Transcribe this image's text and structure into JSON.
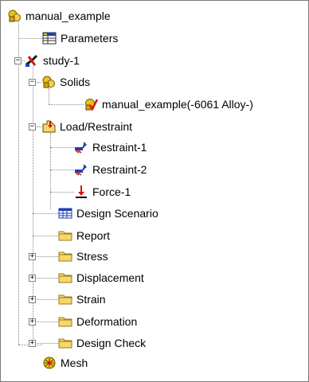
{
  "tree": {
    "root_label": "manual_example",
    "parameters_label": "Parameters",
    "study_label": "study-1",
    "solids_label": "Solids",
    "solid_body_label": "manual_example(-6061 Alloy-)",
    "load_restraint_label": "Load/Restraint",
    "restraint1_label": "Restraint-1",
    "restraint2_label": "Restraint-2",
    "force1_label": "Force-1",
    "design_scenario_label": "Design Scenario",
    "report_label": "Report",
    "stress_label": "Stress",
    "displacement_label": "Displacement",
    "strain_label": "Strain",
    "deformation_label": "Deformation",
    "design_check_label": "Design Check",
    "mesh_label": "Mesh",
    "expanded_symbol": "−",
    "collapsed_symbol": "+"
  },
  "icons": {
    "root": "assembly-part-icon",
    "parameters": "parameters-icon",
    "study": "study-icon",
    "solids": "solids-icon",
    "solid_body": "solid-body-icon",
    "load_restraint": "load-restraint-icon",
    "restraint": "restraint-icon",
    "force": "force-icon",
    "design_scenario": "design-scenario-icon",
    "folder": "folder-icon",
    "mesh": "mesh-icon"
  },
  "colors": {
    "folder_fill": "#f5d86b",
    "folder_edge": "#9a7a18",
    "force_red": "#e01010",
    "restraint_blue": "#1f3fb0",
    "gear_yellow": "#e8c21a",
    "check_red": "#d01818"
  }
}
